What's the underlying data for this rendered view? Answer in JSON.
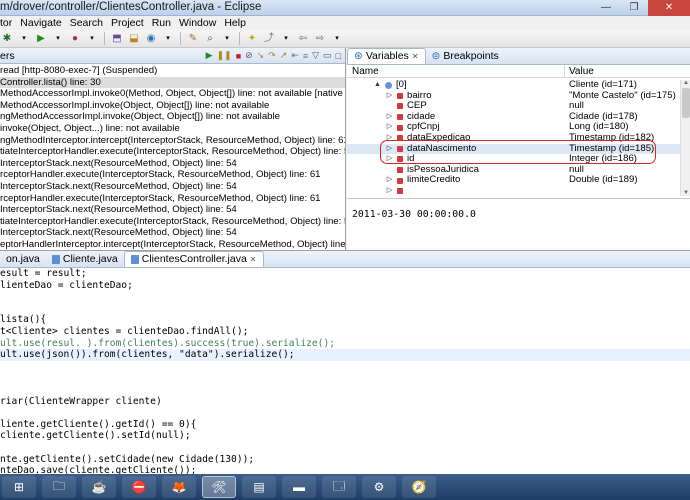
{
  "window": {
    "title": "m/drover/controller/ClientesController.java - Eclipse",
    "controls": [
      "—",
      "❐",
      "✕"
    ]
  },
  "menu": [
    "tor",
    "Navigate",
    "Search",
    "Project",
    "Run",
    "Window",
    "Help"
  ],
  "debug": {
    "tab_label": "ers",
    "frames": [
      "read [http-8080-exec-7] (Suspended)",
      "Controller.lista() line: 30",
      "MethodAccessorImpl.invoke0(Method, Object, Object[]) line: not available [native method]",
      "MethodAccessorImpl.invoke(Object, Object[]) line: not available",
      "ngMethodAccessorImpl.invoke(Object, Object[]) line: not available",
      "invoke(Object, Object...) line: not available",
      "ngMethodInterceptor.intercept(InterceptorStack, ResourceMethod, Object) line: 61",
      "tiateInterceptorHandler.execute(InterceptorStack, ResourceMethod, Object) line: 54",
      "InterceptorStack.next(ResourceMethod, Object) line: 54",
      "rceptorHandler.execute(InterceptorStack, ResourceMethod, Object) line: 61",
      "InterceptorStack.next(ResourceMethod, Object) line: 54",
      "rceptorHandler.execute(InterceptorStack, ResourceMethod, Object) line: 61",
      "InterceptorStack.next(ResourceMethod, Object) line: 54",
      "tiateInterceptorHandler.execute(InterceptorStack, ResourceMethod, Object) line: 56",
      "InterceptorStack.next(ResourceMethod, Object) line: 54",
      "eptorHandlerInterceptor.intercept(InterceptorStack, ResourceMethod, Object) line: 71"
    ]
  },
  "variables": {
    "tabs": [
      "Variables",
      "Breakpoints"
    ],
    "col_name": "Name",
    "col_value": "Value",
    "rows": [
      {
        "name": "[0]",
        "value": "Cliente  (id=171)"
      },
      {
        "name": "bairro",
        "value": "\"Monte Castelo\" (id=175)"
      },
      {
        "name": "CEP",
        "value": "null"
      },
      {
        "name": "cidade",
        "value": "Cidade  (id=178)"
      },
      {
        "name": "cpfCnpj",
        "value": "Long  (id=180)"
      },
      {
        "name": "dataExpedicao",
        "value": "Timestamp  (id=182)"
      },
      {
        "name": "dataNascimento",
        "value": "Timestamp  (id=185)"
      },
      {
        "name": "id",
        "value": "Integer  (id=186)"
      },
      {
        "name": "isPessoaJuridica",
        "value": "null"
      },
      {
        "name": "limiteCredito",
        "value": "Double  (id=189)"
      },
      {
        "name": "",
        "value": ""
      }
    ],
    "detail": "2011-03-30 00:00:00.0"
  },
  "editor": {
    "tabs": [
      "on.java",
      "Cliente.java",
      "ClientesController.java"
    ],
    "lines": [
      "esult = result;",
      "lienteDao = clienteDao;",
      "",
      "",
      "lista(){",
      "t<Cliente> clientes = clienteDao.findAll();",
      "ult.use(resul. ).from(clientes).success(true).serialize();",
      "ult.use(json()).from(clientes, \"data\").serialize();",
      "",
      "",
      "",
      "riar(ClienteWrapper cliente)",
      "",
      "liente.getCliente().getId() == 0){",
      "cliente.getCliente().setId(null);",
      "",
      "nte.getCliente().setCidade(new Cidade(130));",
      "nteDao.save(cliente.getCliente());"
    ]
  },
  "taskbar": {
    "items": [
      "⊞",
      "🗀",
      "☕",
      "⛔",
      "🦊",
      "🛠",
      "▤",
      "▬",
      "🗔",
      "⚙",
      "🧭"
    ]
  }
}
